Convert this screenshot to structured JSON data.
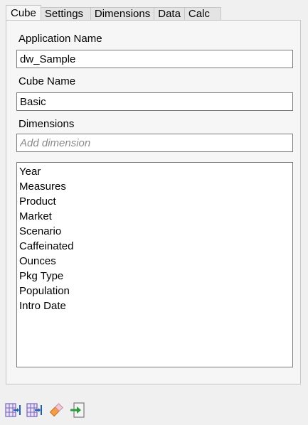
{
  "tabs": [
    "Cube",
    "Settings",
    "Dimensions",
    "Data",
    "Calc"
  ],
  "form": {
    "app_label": "Application Name",
    "app_value": "dw_Sample",
    "cube_label": "Cube Name",
    "cube_value": "Basic",
    "dims_label": "Dimensions",
    "dims_placeholder": "Add dimension"
  },
  "dimensions": [
    "Year",
    "Measures",
    "Product",
    "Market",
    "Scenario",
    "Caffeinated",
    "Ounces",
    "Pkg Type",
    "Population",
    "Intro Date"
  ],
  "toolbar": {
    "icons": [
      "grid-import-icon",
      "grid-export-icon",
      "eraser-icon",
      "exit-icon"
    ]
  }
}
